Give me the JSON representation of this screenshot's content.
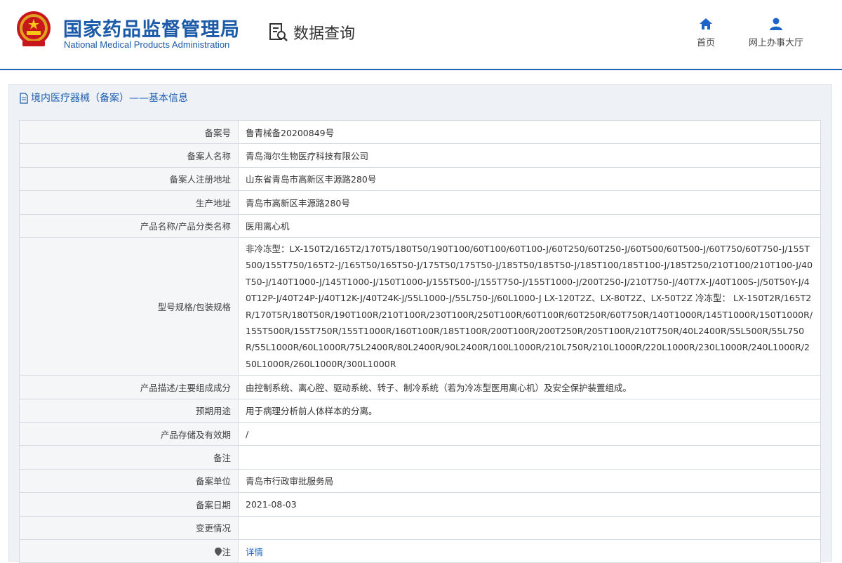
{
  "header": {
    "logo_cn": "国家药品监督管理局",
    "logo_en": "National Medical Products Administration",
    "search_title": "数据查询",
    "nav_home": "首页",
    "nav_hall": "网上办事大厅"
  },
  "panel": {
    "title": "境内医疗器械（备案）——基本信息"
  },
  "rows": [
    {
      "label": "备案号",
      "value": "鲁青械备20200849号"
    },
    {
      "label": "备案人名称",
      "value": "青岛海尔生物医疗科技有限公司"
    },
    {
      "label": "备案人注册地址",
      "value": "山东省青岛市高新区丰源路280号"
    },
    {
      "label": "生产地址",
      "value": "青岛市高新区丰源路280号"
    },
    {
      "label": "产品名称/产品分类名称",
      "value": "医用离心机"
    },
    {
      "label": "型号规格/包装规格",
      "value": "非冷冻型：LX-150T2/165T2/170T5/180T50/190T100/60T100/60T100-J/60T250/60T250-J/60T500/60T500-J/60T750/60T750-J/155T500/155T750/165T2-J/165T50/165T50-J/175T50/175T50-J/185T50/185T50-J/185T100/185T100-J/185T250/210T100/210T100-J/40T50-J/140T1000-J/145T1000-J/150T1000-J/155T500-J/155T750-J/155T1000-J/200T250-J/210T750-J/40T7X-J/40T100S-J/50T50Y-J/40T12P-J/40T24P-J/40T12K-J/40T24K-J/55L1000-J/55L750-J/60L1000-J LX-120T2Z、LX-80T2Z、LX-50T2Z 冷冻型： LX-150T2R/165T2R/170T5R/180T50R/190T100R/210T100R/230T100R/250T100R/60T100R/60T250R/60T750R/140T1000R/145T1000R/150T1000R/155T500R/155T750R/155T1000R/160T100R/185T100R/200T100R/200T250R/205T100R/210T750R/40L2400R/55L500R/55L750R/55L1000R/60L1000R/75L2400R/80L2400R/90L2400R/100L1000R/210L750R/210L1000R/220L1000R/230L1000R/240L1000R/250L1000R/260L1000R/300L1000R"
    },
    {
      "label": "产品描述/主要组成成分",
      "value": "由控制系统、离心腔、驱动系统、转子、制冷系统（若为冷冻型医用离心机）及安全保护装置组成。"
    },
    {
      "label": "预期用途",
      "value": "用于病理分析前人体样本的分离。"
    },
    {
      "label": "产品存储及有效期",
      "value": "/"
    },
    {
      "label": "备注",
      "value": ""
    },
    {
      "label": "备案单位",
      "value": "青岛市行政审批服务局"
    },
    {
      "label": "备案日期",
      "value": "2021-08-03"
    },
    {
      "label": "变更情况",
      "value": ""
    },
    {
      "label": "注",
      "value": "详情"
    }
  ]
}
